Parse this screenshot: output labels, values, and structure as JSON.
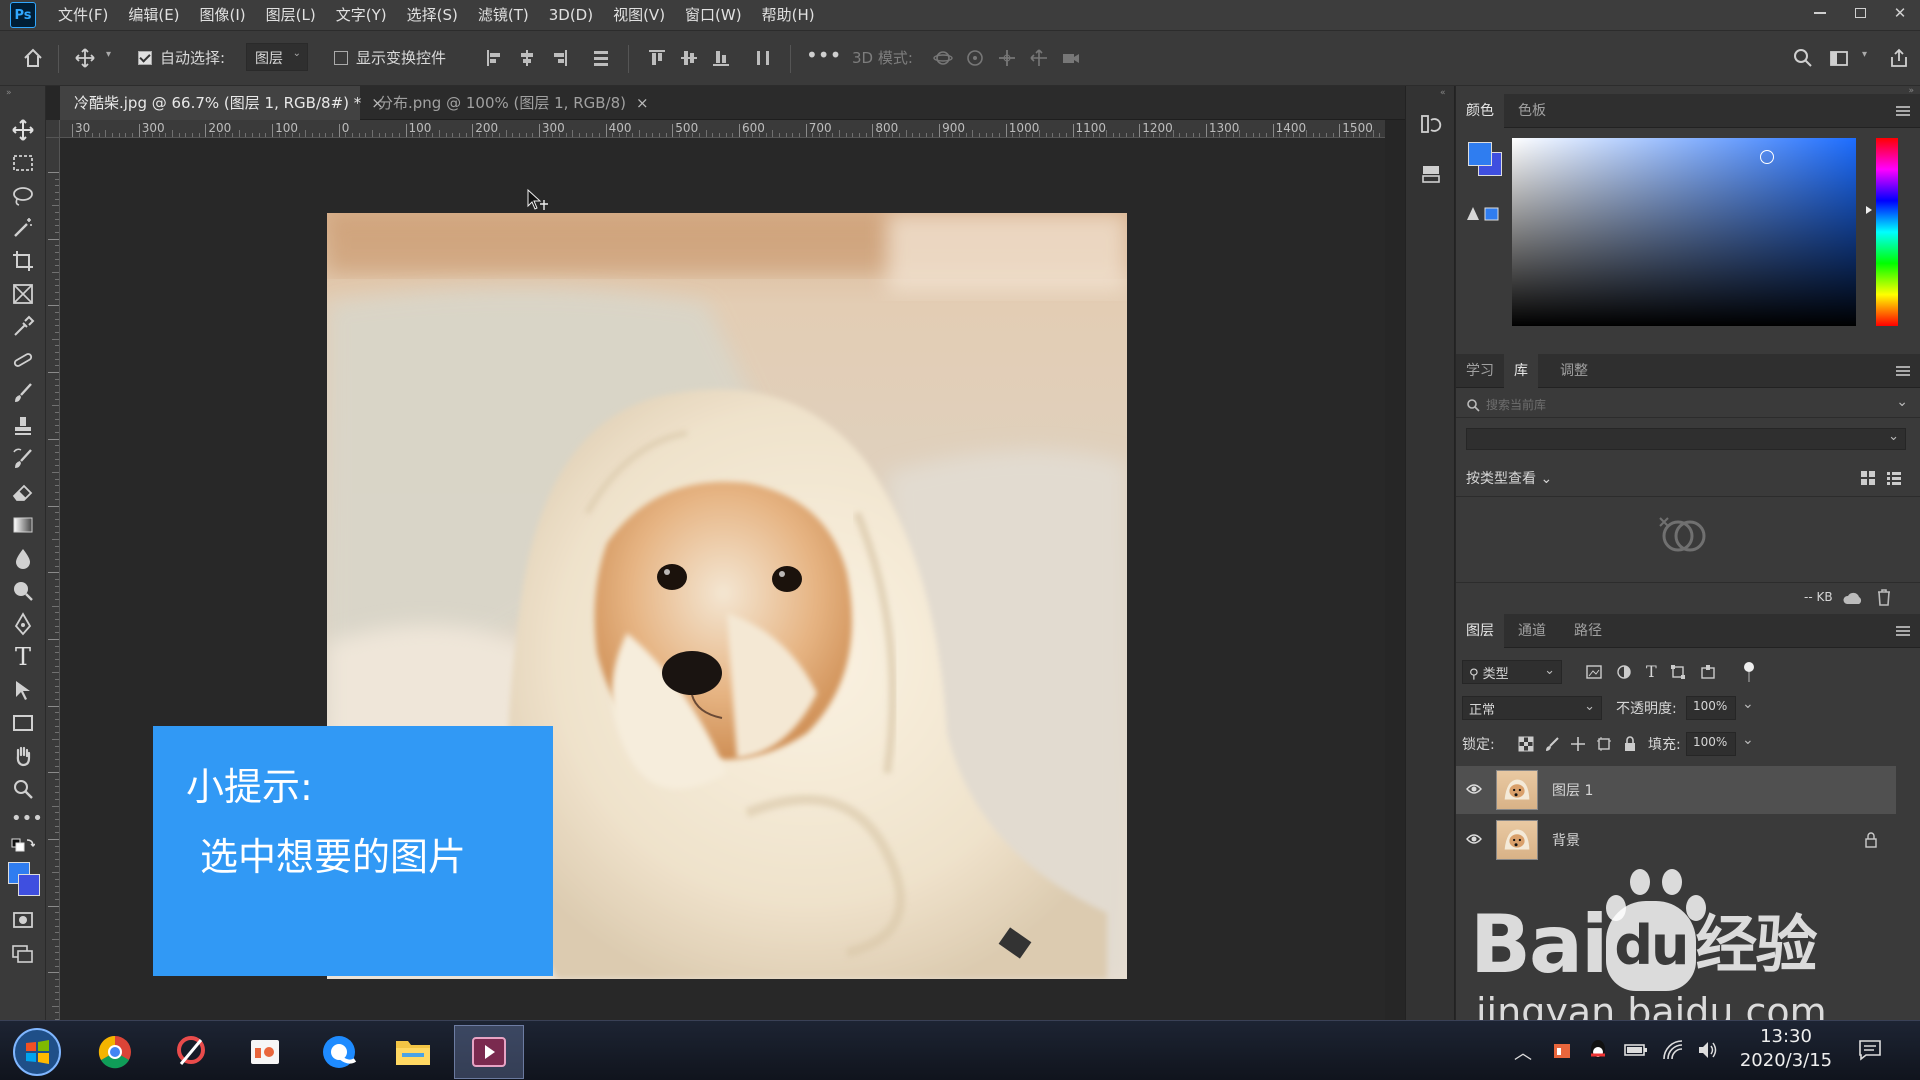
{
  "menubar": {
    "logo": "Ps",
    "items": [
      "文件(F)",
      "编辑(E)",
      "图像(I)",
      "图层(L)",
      "文字(Y)",
      "选择(S)",
      "滤镜(T)",
      "3D(D)",
      "视图(V)",
      "窗口(W)",
      "帮助(H)"
    ]
  },
  "options": {
    "auto_select_label": "自动选择:",
    "auto_select_value": "图层",
    "show_transform_label": "显示变换控件",
    "mode_3d_label": "3D 模式:"
  },
  "tabs": [
    {
      "label": "冷酷柴.jpg @ 66.7% (图层 1, RGB/8#) *",
      "close": "×"
    },
    {
      "label": "分布.png @ 100% (图层 1, RGB/8)",
      "close": "×"
    }
  ],
  "ruler": {
    "h_ticks": [
      "30",
      "300",
      "200",
      "100",
      "0",
      "100",
      "200",
      "300",
      "400",
      "500",
      "600",
      "700",
      "800",
      "900",
      "1000",
      "1100",
      "1200",
      "1300",
      "1400",
      "1500"
    ]
  },
  "tip": {
    "line1": "小提示:",
    "line2": "选中想要的图片"
  },
  "color_panel": {
    "tabs": [
      "颜色",
      "色板"
    ],
    "fg_color": "#2f7df0",
    "bg_color": "#3f4fe0"
  },
  "library_panel": {
    "tabs": [
      "学习",
      "库",
      "调整"
    ],
    "search_placeholder": "搜索当前库",
    "view_by": "按类型查看",
    "size_label": "-- KB"
  },
  "layers_panel": {
    "tabs": [
      "图层",
      "通道",
      "路径"
    ],
    "filter_kind": "类型",
    "blend_mode": "正常",
    "opacity_label": "不透明度:",
    "opacity_value": "100%",
    "lock_label": "锁定:",
    "fill_label": "填充:",
    "fill_value": "100%",
    "layers": [
      {
        "name": "图层 1",
        "selected": true
      },
      {
        "name": "背景",
        "locked": true
      }
    ]
  },
  "taskbar": {
    "time": "13:30",
    "date": "2020/3/15"
  },
  "watermark": {
    "brand": "Bai",
    "brand2": "du",
    "brand3": "经验",
    "url": "jingyan.baidu.com"
  },
  "colors": {
    "accent": "#31a8ff",
    "tip_bg": "#3199f5"
  }
}
